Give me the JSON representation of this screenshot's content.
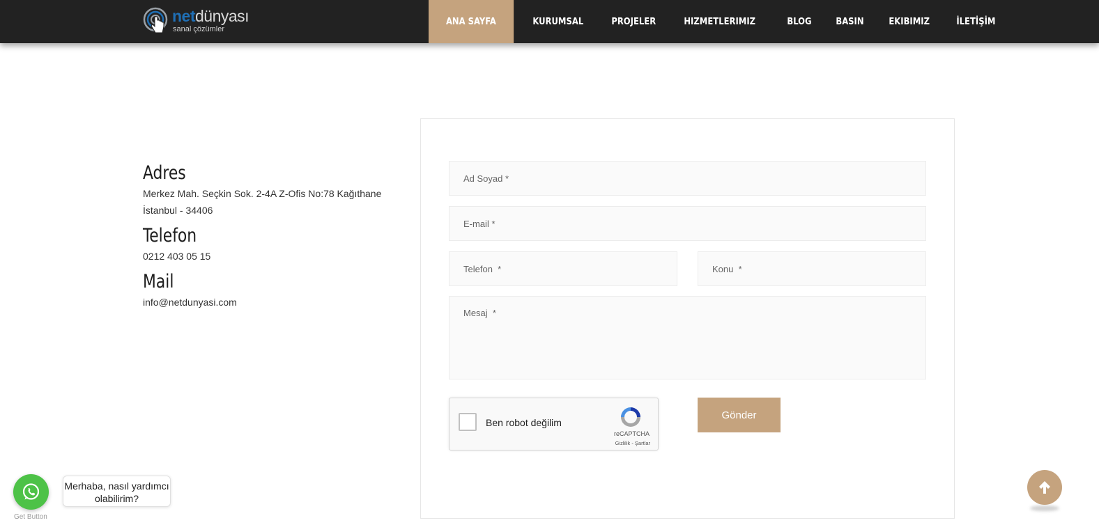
{
  "header": {
    "logo": {
      "brand_net": "net",
      "brand_rest": "dünyası",
      "tagline": "sanal çözümler"
    },
    "nav": [
      {
        "label": "ANA SAYFA",
        "active": true
      },
      {
        "label": "KURUMSAL"
      },
      {
        "label": "PROJELER"
      },
      {
        "label": "HIZMETLERIMIZ"
      },
      {
        "label": "BLOG"
      },
      {
        "label": "BASIN"
      },
      {
        "label": "EKIBIMIZ"
      },
      {
        "label": "İLETİŞİM"
      }
    ]
  },
  "contact": {
    "address_title": "Adres",
    "address_line1": "Merkez Mah. Seçkin Sok. 2-4A Z-Ofis No:78 Kağıthane",
    "address_line2": "İstanbul - 34406",
    "phone_title": "Telefon",
    "phone": "0212 403 05 15",
    "mail_title": "Mail",
    "mail": "info@netdunyasi.com"
  },
  "form": {
    "name_placeholder": "Ad Soyad *",
    "email_placeholder": "E-mail *",
    "phone_placeholder": "Telefon  *",
    "subject_placeholder": "Konu  *",
    "message_placeholder": "Mesaj  *",
    "captcha_label": "Ben robot değilim",
    "captcha_brand": "reCAPTCHA",
    "captcha_terms": "Gizlilik - Şartlar",
    "submit_label": "Gönder"
  },
  "widgets": {
    "whatsapp_message": "Merhaba, nasıl yardımcı olabilirim?",
    "whatsapp_label": "Get Button"
  },
  "colors": {
    "accent": "#c5a37e",
    "header_bg": "#222222",
    "whatsapp": "#4dc247"
  }
}
